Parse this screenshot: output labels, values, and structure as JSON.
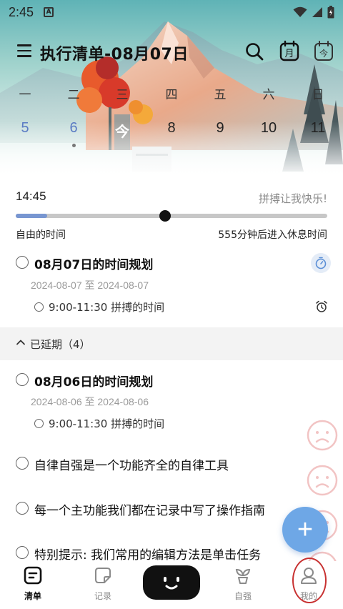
{
  "status_bar": {
    "time": "2:45",
    "notification_icon": "A"
  },
  "header": {
    "title": "执行清单-08月07日",
    "month_icon_label": "月",
    "today_icon_label": "今"
  },
  "week": {
    "day_names": [
      "一",
      "二",
      "三",
      "四",
      "五",
      "六",
      "日"
    ],
    "dates": [
      "5",
      "6",
      "今",
      "8",
      "9",
      "10",
      "11"
    ]
  },
  "time_block": {
    "current_time": "14:45",
    "motto": "拼搏让我快乐!",
    "free_label": "自由的时间",
    "rest_label": "555分钟后进入休息时间",
    "progress": 0.1
  },
  "tasks": [
    {
      "title": "08月07日的时间规划",
      "dates": "2024-08-07 至 2024-08-07",
      "sub": "9:00-11:30 拼搏的时间"
    }
  ],
  "delayed": {
    "label": "已延期（4）",
    "items": [
      {
        "title": "08月06日的时间规划",
        "dates": "2024-08-06 至 2024-08-06",
        "sub": "9:00-11:30 拼搏的时间"
      },
      {
        "title": "自律自强是一个功能齐全的自律工具"
      },
      {
        "title": "每一个主功能我们都在记录中写了操作指南"
      },
      {
        "title": "特别提示: 我们常用的编辑方法是单击任务"
      }
    ]
  },
  "fab": {
    "label": "+"
  },
  "bottom_nav": [
    {
      "label": "清单",
      "icon": "list-icon",
      "active": true
    },
    {
      "label": "记录",
      "icon": "note-icon",
      "active": false
    },
    {
      "label": "",
      "icon": "face-icon",
      "active": false
    },
    {
      "label": "自强",
      "icon": "sprout-icon",
      "active": false
    },
    {
      "label": "我的",
      "icon": "user-icon",
      "active": false
    }
  ],
  "colors": {
    "accent": "#6ea7e6",
    "past_date": "#5a7bc4",
    "highlight_ring": "#c83232"
  }
}
